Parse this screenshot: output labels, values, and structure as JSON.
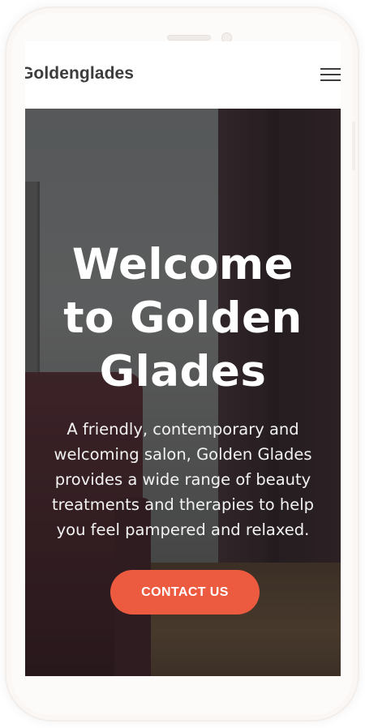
{
  "header": {
    "logo_text": "Goldenglades",
    "menu_icon": "hamburger-menu-icon"
  },
  "hero": {
    "title_lines": [
      "Welcome",
      "to Golden",
      "Glades"
    ],
    "text_lines": [
      "A friendly, contemporary and",
      "welcoming salon, Golden Glades",
      "provides a wide range of beauty",
      "treatments and therapies to help",
      "you feel pampered and relaxed."
    ],
    "cta_label": "CONTACT US"
  },
  "colors": {
    "accent": "#ec5b3f",
    "header_bg": "#ffffff",
    "logo_text": "#3c3c3c"
  }
}
